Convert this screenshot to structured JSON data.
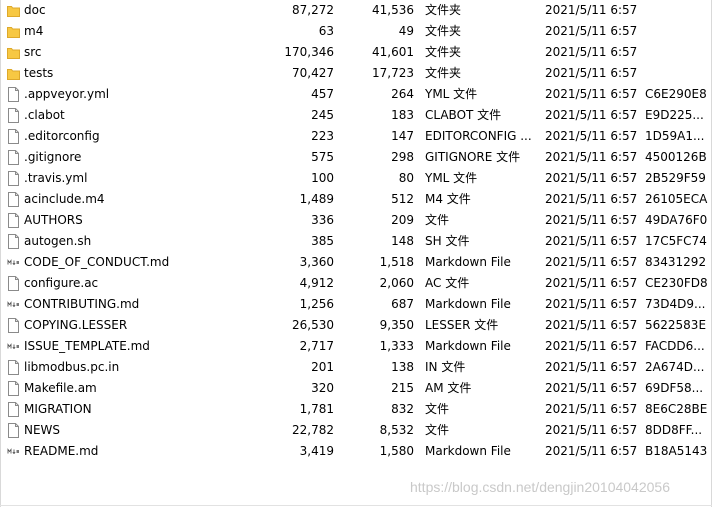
{
  "files": [
    {
      "name": "doc",
      "size": "87,272",
      "packed": "41,536",
      "type": "文件夹",
      "modified": "2021/5/11 6:57",
      "crc": "",
      "icon": "folder-icon"
    },
    {
      "name": "m4",
      "size": "63",
      "packed": "49",
      "type": "文件夹",
      "modified": "2021/5/11 6:57",
      "crc": "",
      "icon": "folder-icon"
    },
    {
      "name": "src",
      "size": "170,346",
      "packed": "41,601",
      "type": "文件夹",
      "modified": "2021/5/11 6:57",
      "crc": "",
      "icon": "folder-icon"
    },
    {
      "name": "tests",
      "size": "70,427",
      "packed": "17,723",
      "type": "文件夹",
      "modified": "2021/5/11 6:57",
      "crc": "",
      "icon": "folder-icon"
    },
    {
      "name": ".appveyor.yml",
      "size": "457",
      "packed": "264",
      "type": "YML 文件",
      "modified": "2021/5/11 6:57",
      "crc": "C6E290E8",
      "icon": "file-icon"
    },
    {
      "name": ".clabot",
      "size": "245",
      "packed": "183",
      "type": "CLABOT 文件",
      "modified": "2021/5/11 6:57",
      "crc": "E9D225...",
      "icon": "file-icon"
    },
    {
      "name": ".editorconfig",
      "size": "223",
      "packed": "147",
      "type": "EDITORCONFIG ...",
      "modified": "2021/5/11 6:57",
      "crc": "1D59A1...",
      "icon": "file-icon"
    },
    {
      "name": ".gitignore",
      "size": "575",
      "packed": "298",
      "type": "GITIGNORE 文件",
      "modified": "2021/5/11 6:57",
      "crc": "4500126B",
      "icon": "file-icon"
    },
    {
      "name": ".travis.yml",
      "size": "100",
      "packed": "80",
      "type": "YML 文件",
      "modified": "2021/5/11 6:57",
      "crc": "2B529F59",
      "icon": "file-icon"
    },
    {
      "name": "acinclude.m4",
      "size": "1,489",
      "packed": "512",
      "type": "M4 文件",
      "modified": "2021/5/11 6:57",
      "crc": "26105ECA",
      "icon": "file-icon"
    },
    {
      "name": "AUTHORS",
      "size": "336",
      "packed": "209",
      "type": "文件",
      "modified": "2021/5/11 6:57",
      "crc": "49DA76F0",
      "icon": "file-icon"
    },
    {
      "name": "autogen.sh",
      "size": "385",
      "packed": "148",
      "type": "SH 文件",
      "modified": "2021/5/11 6:57",
      "crc": "17C5FC74",
      "icon": "file-icon"
    },
    {
      "name": "CODE_OF_CONDUCT.md",
      "size": "3,360",
      "packed": "1,518",
      "type": "Markdown File",
      "modified": "2021/5/11 6:57",
      "crc": "83431292",
      "icon": "markdown-file-icon"
    },
    {
      "name": "configure.ac",
      "size": "4,912",
      "packed": "2,060",
      "type": "AC 文件",
      "modified": "2021/5/11 6:57",
      "crc": "CE230FD8",
      "icon": "file-icon"
    },
    {
      "name": "CONTRIBUTING.md",
      "size": "1,256",
      "packed": "687",
      "type": "Markdown File",
      "modified": "2021/5/11 6:57",
      "crc": "73D4D9...",
      "icon": "markdown-file-icon"
    },
    {
      "name": "COPYING.LESSER",
      "size": "26,530",
      "packed": "9,350",
      "type": "LESSER 文件",
      "modified": "2021/5/11 6:57",
      "crc": "5622583E",
      "icon": "file-icon"
    },
    {
      "name": "ISSUE_TEMPLATE.md",
      "size": "2,717",
      "packed": "1,333",
      "type": "Markdown File",
      "modified": "2021/5/11 6:57",
      "crc": "FACDD6...",
      "icon": "markdown-file-icon"
    },
    {
      "name": "libmodbus.pc.in",
      "size": "201",
      "packed": "138",
      "type": "IN 文件",
      "modified": "2021/5/11 6:57",
      "crc": "2A674D...",
      "icon": "file-icon"
    },
    {
      "name": "Makefile.am",
      "size": "320",
      "packed": "215",
      "type": "AM 文件",
      "modified": "2021/5/11 6:57",
      "crc": "69DF58...",
      "icon": "file-icon"
    },
    {
      "name": "MIGRATION",
      "size": "1,781",
      "packed": "832",
      "type": "文件",
      "modified": "2021/5/11 6:57",
      "crc": "8E6C28BE",
      "icon": "file-icon"
    },
    {
      "name": "NEWS",
      "size": "22,782",
      "packed": "8,532",
      "type": "文件",
      "modified": "2021/5/11 6:57",
      "crc": "8DD8FF...",
      "icon": "file-icon"
    },
    {
      "name": "README.md",
      "size": "3,419",
      "packed": "1,580",
      "type": "Markdown File",
      "modified": "2021/5/11 6:57",
      "crc": "B18A5143",
      "icon": "markdown-file-icon"
    }
  ],
  "watermark": "https://blog.csdn.net/dengjin20104042056",
  "colors": {
    "folder": "#F7C843",
    "folder_dark": "#DEA92B",
    "file_border": "#8a8a8a"
  }
}
